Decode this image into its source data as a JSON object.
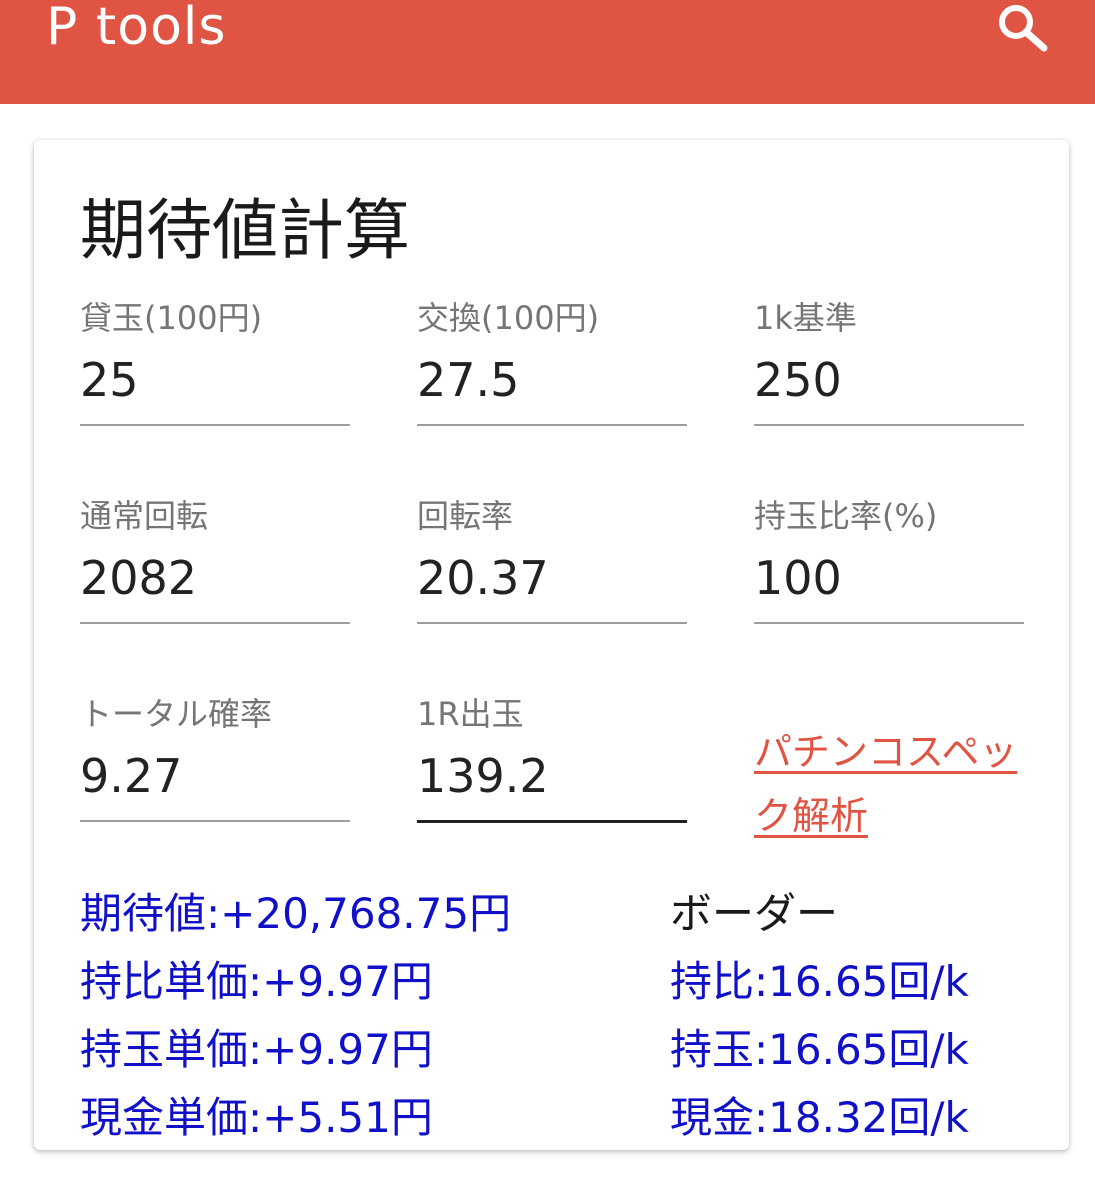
{
  "appbar": {
    "title": "P tools",
    "search_icon": "search-icon"
  },
  "card": {
    "title": "期待値計算",
    "fields": [
      {
        "label": "貸玉(100円)",
        "value": "25"
      },
      {
        "label": "交換(100円)",
        "value": "27.5"
      },
      {
        "label": "1k基準",
        "value": "250"
      },
      {
        "label": "通常回転",
        "value": "2082"
      },
      {
        "label": "回転率",
        "value": "20.37"
      },
      {
        "label": "持玉比率(%)",
        "value": "100"
      },
      {
        "label": "トータル確率",
        "value": "9.27"
      },
      {
        "label": "1R出玉",
        "value": "139.2"
      }
    ],
    "spec_link": "パチンコスペック解析",
    "results": {
      "expected_value": "期待値:+20,768.75円",
      "mixed_unit_price": "持比単価:+9.97円",
      "ball_unit_price": "持玉単価:+9.97円",
      "cash_unit_price": "現金単価:+5.51円"
    },
    "border": {
      "heading": "ボーダー",
      "mixed": "持比:16.65回/k",
      "ball": "持玉:16.65回/k",
      "cash": "現金:18.32回/k"
    }
  },
  "colors": {
    "appbar": "#e05444",
    "link": "#e05444",
    "result_text": "#1010c8",
    "label": "#757575"
  }
}
